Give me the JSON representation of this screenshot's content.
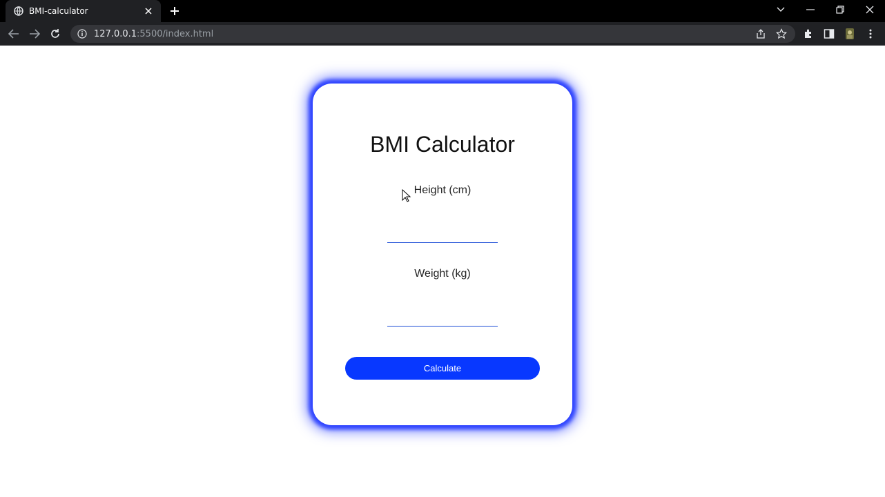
{
  "browser": {
    "tab_title": "BMI-calculator",
    "url_host": "127.0.0.1",
    "url_path": ":5500/index.html"
  },
  "card": {
    "title": "BMI Calculator",
    "height_label": "Height (cm)",
    "height_value": "",
    "weight_label": "Weight (kg)",
    "weight_value": "",
    "button_label": "Calculate"
  },
  "colors": {
    "accent": "#0838ff",
    "glow": "#2f44ff",
    "chrome_bg": "#202124",
    "tabstrip_bg": "#000000"
  }
}
